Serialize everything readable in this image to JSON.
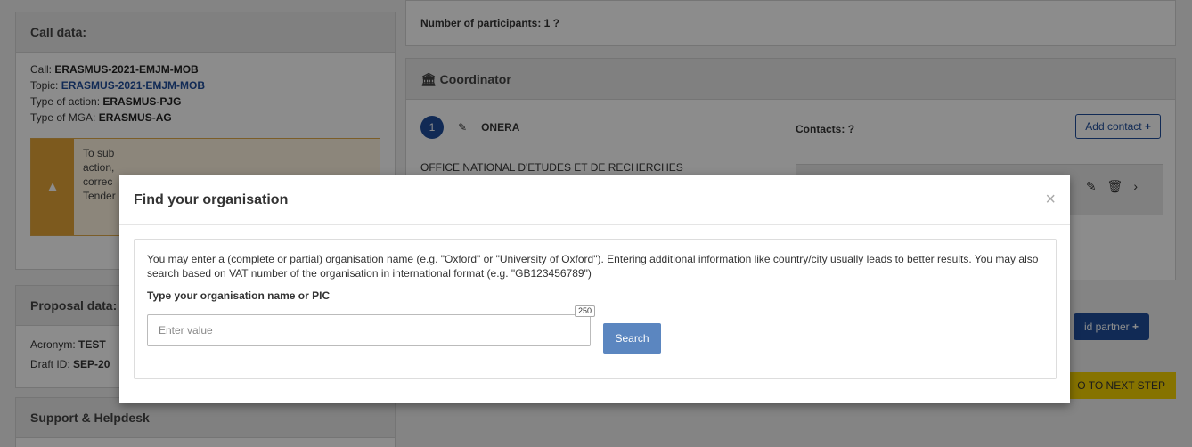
{
  "call_panel": {
    "title": "Call data:",
    "call_label": "Call: ",
    "call_value": "ERASMUS-2021-EMJM-MOB",
    "topic_label": "Topic: ",
    "topic_value": "ERASMUS-2021-EMJM-MOB",
    "action_label": "Type of action: ",
    "action_value": "ERASMUS-PJG",
    "mga_label": "Type of MGA: ",
    "mga_value": "ERASMUS-AG",
    "warning_lines": [
      "To sub",
      "action,",
      "correc",
      "Tender"
    ]
  },
  "proposal_panel": {
    "title": "Proposal data:",
    "acronym_label": "Acronym: ",
    "acronym_value": "TEST",
    "draft_label": "Draft ID: ",
    "draft_value": "SEP-20"
  },
  "support_panel": {
    "title": "Support & Helpdesk"
  },
  "participants": {
    "text": "Number of participants: 1"
  },
  "coordinator": {
    "title": "Coordinator",
    "number": "1",
    "org_short": "ONERA",
    "org_full": "OFFICE NATIONAL D'ETUDES ET DE RECHERCHES",
    "contacts_label": "Contacts:",
    "add_contact_label": "Add contact"
  },
  "actions": {
    "add_partner_label": "id partner",
    "next_step_label": "O TO NEXT STEP"
  },
  "modal": {
    "title": "Find your organisation",
    "intro": "You may enter a (complete or partial) organisation name (e.g. \"Oxford\" or \"University of Oxford\"). Entering additional information like country/city usually leads to better results. You may also search based on VAT number of the organisation in international format (e.g. \"GB123456789\")",
    "field_label": "Type your organisation name or PIC",
    "input_placeholder": "Enter value",
    "input_value": "",
    "char_counter": "250",
    "search_label": "Search"
  }
}
